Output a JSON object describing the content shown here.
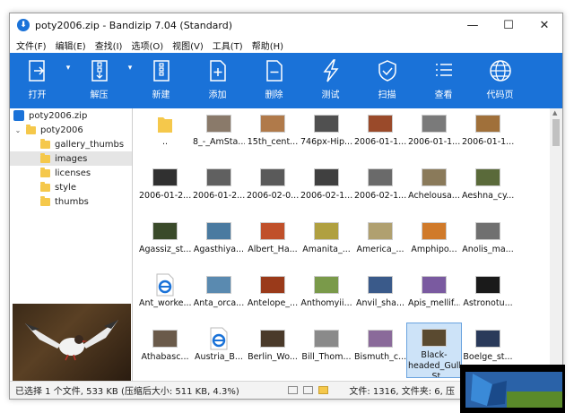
{
  "window": {
    "title": "poty2006.zip - Bandizip 7.04 (Standard)",
    "controls": {
      "minimize": "—",
      "maximize": "☐",
      "close": "✕"
    }
  },
  "menu": [
    "文件(F)",
    "编辑(E)",
    "查找(I)",
    "选项(O)",
    "视图(V)",
    "工具(T)",
    "帮助(H)"
  ],
  "toolbar": {
    "accent": "#1a72d8",
    "items": [
      {
        "label": "打开",
        "icon": "open-icon"
      },
      {
        "label": "解压",
        "icon": "extract-icon"
      },
      {
        "label": "新建",
        "icon": "new-archive-icon"
      },
      {
        "label": "添加",
        "icon": "add-icon"
      },
      {
        "label": "删除",
        "icon": "delete-icon"
      },
      {
        "label": "测试",
        "icon": "test-icon"
      },
      {
        "label": "扫描",
        "icon": "scan-icon"
      },
      {
        "label": "查看",
        "icon": "view-icon"
      },
      {
        "label": "代码页",
        "icon": "codepage-icon"
      }
    ]
  },
  "tree": {
    "root": "poty2006.zip",
    "folder": "poty2006",
    "children": [
      "gallery_thumbs",
      "images",
      "licenses",
      "style",
      "thumbs"
    ],
    "selected": "images"
  },
  "files": [
    {
      "name": "..",
      "kind": "folder"
    },
    {
      "name": "8_-_AmSta...",
      "kind": "photo",
      "color": "#8a7a6a"
    },
    {
      "name": "15th_cent...",
      "kind": "photo",
      "color": "#b07a4a"
    },
    {
      "name": "746px-Hip...",
      "kind": "photo",
      "color": "#505050"
    },
    {
      "name": "2006-01-1...",
      "kind": "photo",
      "color": "#9a4a2a"
    },
    {
      "name": "2006-01-1...",
      "kind": "photo",
      "color": "#7a7a7a"
    },
    {
      "name": "2006-01-1...",
      "kind": "photo",
      "color": "#a0703a"
    },
    {
      "name": "2006-01-2...",
      "kind": "photo",
      "color": "#303030"
    },
    {
      "name": "2006-01-2...",
      "kind": "photo",
      "color": "#606060"
    },
    {
      "name": "2006-02-0...",
      "kind": "photo",
      "color": "#5a5a5a"
    },
    {
      "name": "2006-02-1...",
      "kind": "photo",
      "color": "#404040"
    },
    {
      "name": "2006-02-1...",
      "kind": "photo",
      "color": "#6a6a6a"
    },
    {
      "name": "Achelousa...",
      "kind": "photo",
      "color": "#8a7a5a"
    },
    {
      "name": "Aeshna_cy...",
      "kind": "photo",
      "color": "#5a6a3a"
    },
    {
      "name": "Agassiz_st...",
      "kind": "photo",
      "color": "#3a4a2a"
    },
    {
      "name": "Agasthiya...",
      "kind": "photo",
      "color": "#4a7aa0"
    },
    {
      "name": "Albert_Ha...",
      "kind": "photo",
      "color": "#c0502a"
    },
    {
      "name": "Amanita_...",
      "kind": "photo",
      "color": "#b0a040"
    },
    {
      "name": "America_...",
      "kind": "photo",
      "color": "#b0a070"
    },
    {
      "name": "Amphipo...",
      "kind": "photo",
      "color": "#d07a2a"
    },
    {
      "name": "Anolis_ma...",
      "kind": "photo",
      "color": "#707070"
    },
    {
      "name": "Ant_worke...",
      "kind": "html"
    },
    {
      "name": "Anta_orca...",
      "kind": "photo",
      "color": "#5a8ab0"
    },
    {
      "name": "Antelope_...",
      "kind": "photo",
      "color": "#9a3a1a"
    },
    {
      "name": "Anthomyii...",
      "kind": "photo",
      "color": "#7a9a4a"
    },
    {
      "name": "Anvil_sha...",
      "kind": "photo",
      "color": "#3a5a8a"
    },
    {
      "name": "Apis_mellif...",
      "kind": "photo",
      "color": "#7a5aa0"
    },
    {
      "name": "Astronotu...",
      "kind": "photo",
      "color": "#1a1a1a"
    },
    {
      "name": "Athabasc...",
      "kind": "photo",
      "color": "#6a5a4a"
    },
    {
      "name": "Austria_B...",
      "kind": "html"
    },
    {
      "name": "Berlin_Wo...",
      "kind": "photo",
      "color": "#4a3a2a"
    },
    {
      "name": "Bill_Thom...",
      "kind": "photo",
      "color": "#8a8a8a"
    },
    {
      "name": "Bismuth_c...",
      "kind": "photo",
      "color": "#8a6a9a"
    },
    {
      "name": "Black-headed_Gull_-_St",
      "kind": "photo",
      "color": "#5a4a30",
      "selected": true
    },
    {
      "name": "Boelge_st...",
      "kind": "photo",
      "color": "#2a3a5a"
    }
  ],
  "status": {
    "left": "已选择 1 个文件, 533 KB (压缩后大小: 511 KB, 4.3%)",
    "right": "文件: 1316, 文件夹: 6, 压"
  }
}
